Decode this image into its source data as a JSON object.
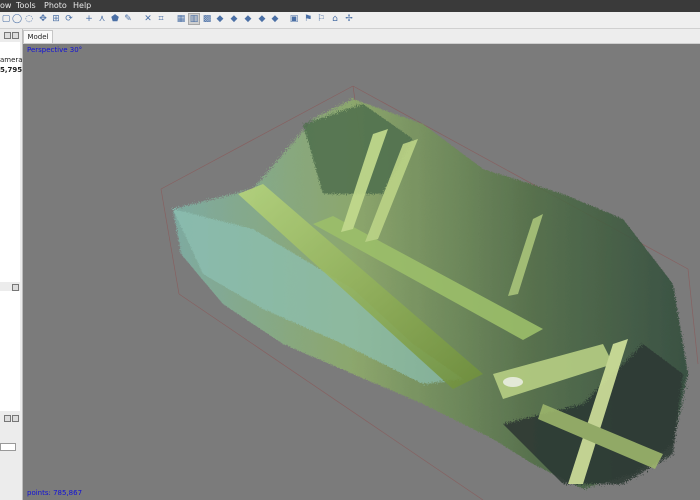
{
  "menu": [
    "ow",
    "Tools",
    "Photo",
    "Help"
  ],
  "toolbar_icons": [
    "select-icon",
    "ellipse-select-icon",
    "free-select-icon",
    "navigate-icon",
    "zoom-icon",
    "rotate-icon",
    "add-point-icon",
    "ruler-icon",
    "shape-icon",
    "measure-icon",
    "delete-icon",
    "crop-icon",
    "grid-icon",
    "solid-view-icon",
    "points-view-icon",
    "dense-cloud-icon",
    "mesh-icon",
    "textured-icon",
    "camera-icon",
    "filter-icon",
    "flag-icon",
    "home-icon",
    "move-icon"
  ],
  "tabs": [
    "Model"
  ],
  "left_panel": {
    "text1": "amera",
    "text2": "5,795"
  },
  "viewport": {
    "projection_label": "Perspective 30°",
    "points_label": "points: 785,867"
  },
  "colors": {
    "background": "#7b7b7b",
    "overlay_text": "#1010d8",
    "bbox": "#8a5a5a"
  }
}
